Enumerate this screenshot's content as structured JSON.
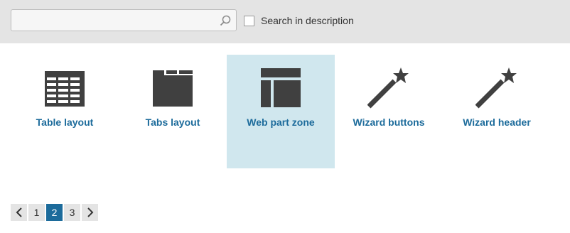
{
  "search": {
    "value": "",
    "placeholder": "",
    "description_checked": false,
    "description_label": "Search in description"
  },
  "tiles": [
    {
      "label": "Table layout",
      "icon": "table-layout-icon",
      "selected": false
    },
    {
      "label": "Tabs layout",
      "icon": "tabs-layout-icon",
      "selected": false
    },
    {
      "label": "Web part zone",
      "icon": "web-part-zone-icon",
      "selected": true
    },
    {
      "label": "Wizard buttons",
      "icon": "magic-wand-icon",
      "selected": false
    },
    {
      "label": "Wizard header",
      "icon": "magic-wand-icon",
      "selected": false
    }
  ],
  "pagination": {
    "pages": [
      "1",
      "2",
      "3"
    ],
    "current": "2"
  },
  "colors": {
    "accent": "#1c6b9b",
    "selected_tile": "#d0e7ee",
    "toolbar": "#e4e4e4",
    "icon": "#404040"
  }
}
